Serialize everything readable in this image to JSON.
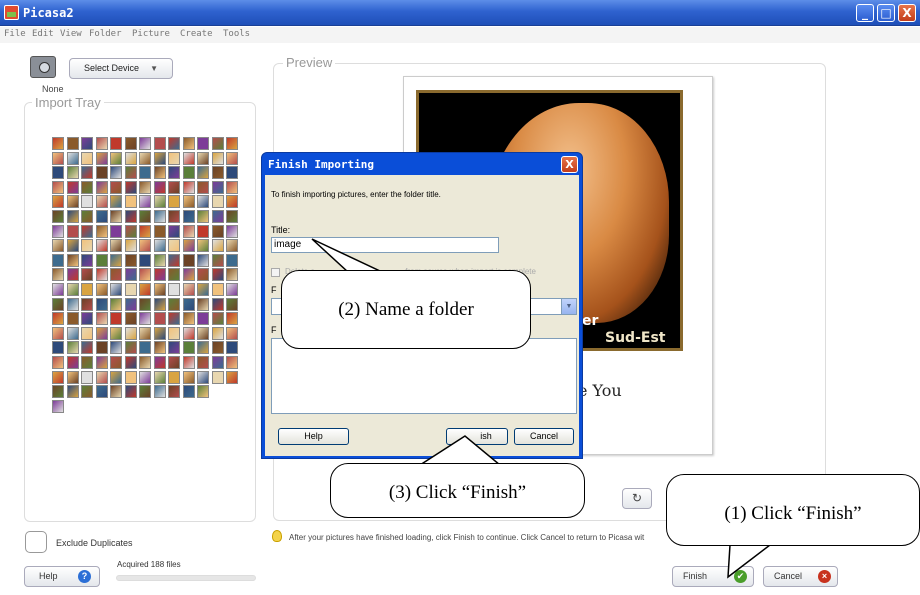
{
  "window": {
    "title": "Picasa2",
    "minimize": "_",
    "maximize": "□",
    "close": "X"
  },
  "menu": [
    "File",
    "Edit",
    "View",
    "Folder",
    "Picture",
    "Create",
    "Tools"
  ],
  "left_panel": {
    "select_device_label": "Select Device",
    "select_device_arrow": "▼",
    "device_value": "None",
    "import_tray_label": "Import Tray",
    "thumbnail_count": 188,
    "exclude_duplicates_label": "Exclude Duplicates",
    "help_label": "Help",
    "help_icon": "?",
    "acquired_text": "Acquired 188 files"
  },
  "preview": {
    "label": "Preview",
    "card_text_line1": "er",
    "card_text_line2": "Sud-Est",
    "card_caption": "e You",
    "rotate_icon": "↻"
  },
  "status": {
    "message": "After your pictures have finished loading, click Finish to continue. Click Cancel to return to Picasa wit"
  },
  "bottom_buttons": {
    "finish_label": "Finish",
    "finish_icon": "✔",
    "cancel_label": "Cancel",
    "cancel_icon": "×"
  },
  "dialog": {
    "title": "Finish Importing",
    "close": "X",
    "instruction": "To finish importing pictures, enter the folder title.",
    "title_label": "Title:",
    "title_value": "image",
    "delete_checkbox_label": "Delete o",
    "delete_checkbox_label_tail": "from source when import is complete",
    "field_label_1": "F",
    "field_label_2": "F",
    "select_arrow": "▼",
    "help_label": "Help",
    "finish_label": "ish",
    "cancel_label": "Cancel"
  },
  "callouts": {
    "name_folder": "(2) Name a folder",
    "click_finish_dialog": "(3) Click “Finish”",
    "click_finish_main": "(1) Click “Finish”"
  },
  "colors": {
    "titlebar": "#2f62cf",
    "dialog_frame": "#0a4ed8",
    "dialog_body": "#ece9d8",
    "card_border": "#8a6a2e"
  }
}
